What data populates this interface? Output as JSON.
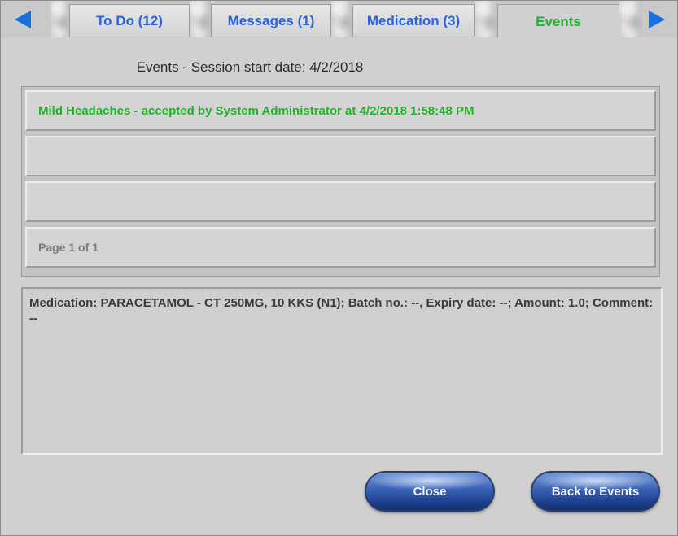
{
  "tabs": [
    {
      "label": "To Do (12)"
    },
    {
      "label": "Messages (1)"
    },
    {
      "label": "Medication (3)"
    },
    {
      "label": "Events"
    }
  ],
  "session_title": "Events - Session start date: 4/2/2018",
  "events": [
    {
      "text": "Mild Headaches - accepted by System Administrator at 4/2/2018 1:58:48 PM"
    },
    {
      "text": ""
    },
    {
      "text": ""
    }
  ],
  "pager": "Page 1 of 1",
  "detail": "Medication: PARACETAMOL - CT 250MG, 10 KKS (N1); Batch no.: --, Expiry date: --; Amount: 1.0; Comment: --",
  "buttons": {
    "close": "Close",
    "back": "Back to Events"
  },
  "colors": {
    "tab_text": "#2a62d9",
    "active_tab_text": "#21b12a",
    "event_text": "#1fb326",
    "arrow": "#1a6fe0"
  },
  "icons": {
    "left_arrow": "triangle-left-icon",
    "right_arrow": "triangle-right-icon"
  }
}
